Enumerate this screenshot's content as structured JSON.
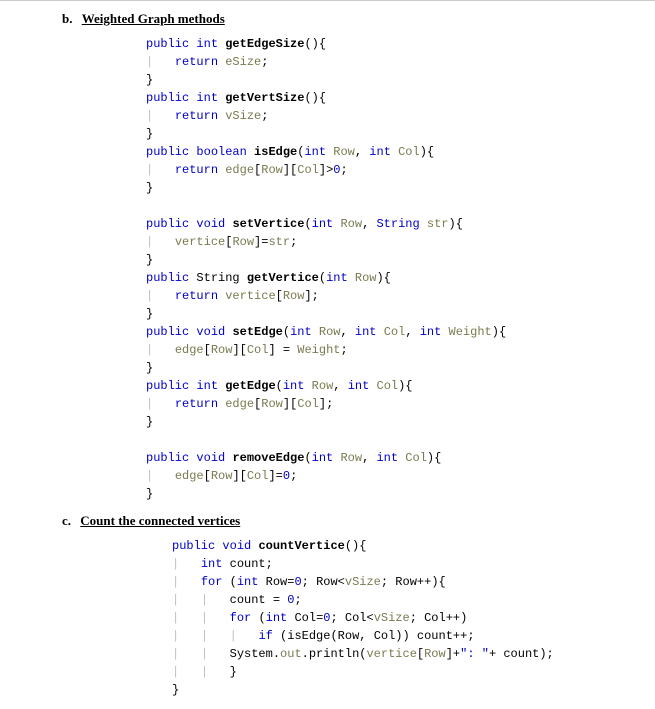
{
  "sections": {
    "b": {
      "letter": "b.",
      "title": "Weighted Graph methods"
    },
    "c": {
      "letter": "c.",
      "title": "Count the connected vertices"
    }
  },
  "code": {
    "b": {
      "getEdgeSize": {
        "modifier": "public",
        "returnType": "int",
        "name": "getEdgeSize",
        "params": "()",
        "body_return": "return",
        "body_var": "eSize"
      },
      "getVertSize": {
        "modifier": "public",
        "returnType": "int",
        "name": "getVertSize",
        "params": "()",
        "body_return": "return",
        "body_var": "vSize"
      },
      "isEdge": {
        "modifier": "public",
        "returnType": "boolean",
        "name": "isEdge",
        "p1type": "int",
        "p1name": "Row",
        "p2type": "int",
        "p2name": "Col",
        "body_return": "return",
        "body_expr_var": "edge",
        "body_expr_idx1": "Row",
        "body_expr_idx2": "Col",
        "body_expr_cmp": ">",
        "body_expr_lit": "0"
      },
      "setVertice": {
        "modifier": "public",
        "returnType": "void",
        "name": "setVertice",
        "p1type": "int",
        "p1name": "Row",
        "p2type": "String",
        "p2name": "str",
        "body_var": "vertice",
        "body_idx": "Row",
        "body_assign": "=",
        "body_val": "str"
      },
      "getVertice": {
        "modifier": "public",
        "returnType": "String",
        "name": "getVertice",
        "p1type": "int",
        "p1name": "Row",
        "body_return": "return",
        "body_var": "vertice",
        "body_idx": "Row"
      },
      "setEdge": {
        "modifier": "public",
        "returnType": "void",
        "name": "setEdge",
        "p1type": "int",
        "p1name": "Row",
        "p2type": "int",
        "p2name": "Col",
        "p3type": "int",
        "p3name": "Weight",
        "body_var": "edge",
        "body_idx1": "Row",
        "body_idx2": "Col",
        "body_assign": " = ",
        "body_val": "Weight"
      },
      "getEdge": {
        "modifier": "public",
        "returnType": "int",
        "name": "getEdge",
        "p1type": "int",
        "p1name": "Row",
        "p2type": "int",
        "p2name": "Col",
        "body_return": "return",
        "body_var": "edge",
        "body_idx1": "Row",
        "body_idx2": "Col"
      },
      "removeEdge": {
        "modifier": "public",
        "returnType": "void",
        "name": "removeEdge",
        "p1type": "int",
        "p1name": "Row",
        "p2type": "int",
        "p2name": "Col",
        "body_var": "edge",
        "body_idx1": "Row",
        "body_idx2": "Col",
        "body_assign": "=",
        "body_lit": "0"
      }
    },
    "c": {
      "countVertice": {
        "modifier": "public",
        "returnType": "void",
        "name": "countVertice",
        "params": "()",
        "decl_type": "int",
        "decl_name": "count",
        "for1_kw": "for",
        "for1_type": "int",
        "for1_var": "Row",
        "for1_init": "=",
        "for1_initlit": "0",
        "for1_cond_var": "Row",
        "for1_cond_cmp": "<",
        "for1_cond_field": "vSize",
        "for1_inc": "Row++",
        "assign_var": "count",
        "assign_op": " = ",
        "assign_lit": "0",
        "for2_kw": "for",
        "for2_type": "int",
        "for2_var": "Col",
        "for2_init": "=",
        "for2_initlit": "0",
        "for2_cond_var": "Col",
        "for2_cond_cmp": "<",
        "for2_cond_field": "vSize",
        "for2_inc": "Col++",
        "if_kw": "if",
        "if_call": "isEdge",
        "if_arg1": "Row",
        "if_arg2": "Col",
        "if_action": "count++",
        "print_obj": "System",
        "print_out": "out",
        "print_method": "println",
        "print_arg_var": "vertice",
        "print_arg_idx": "Row",
        "print_concat": "+",
        "print_str": "\": \"",
        "print_concat2": "+ count"
      }
    }
  }
}
